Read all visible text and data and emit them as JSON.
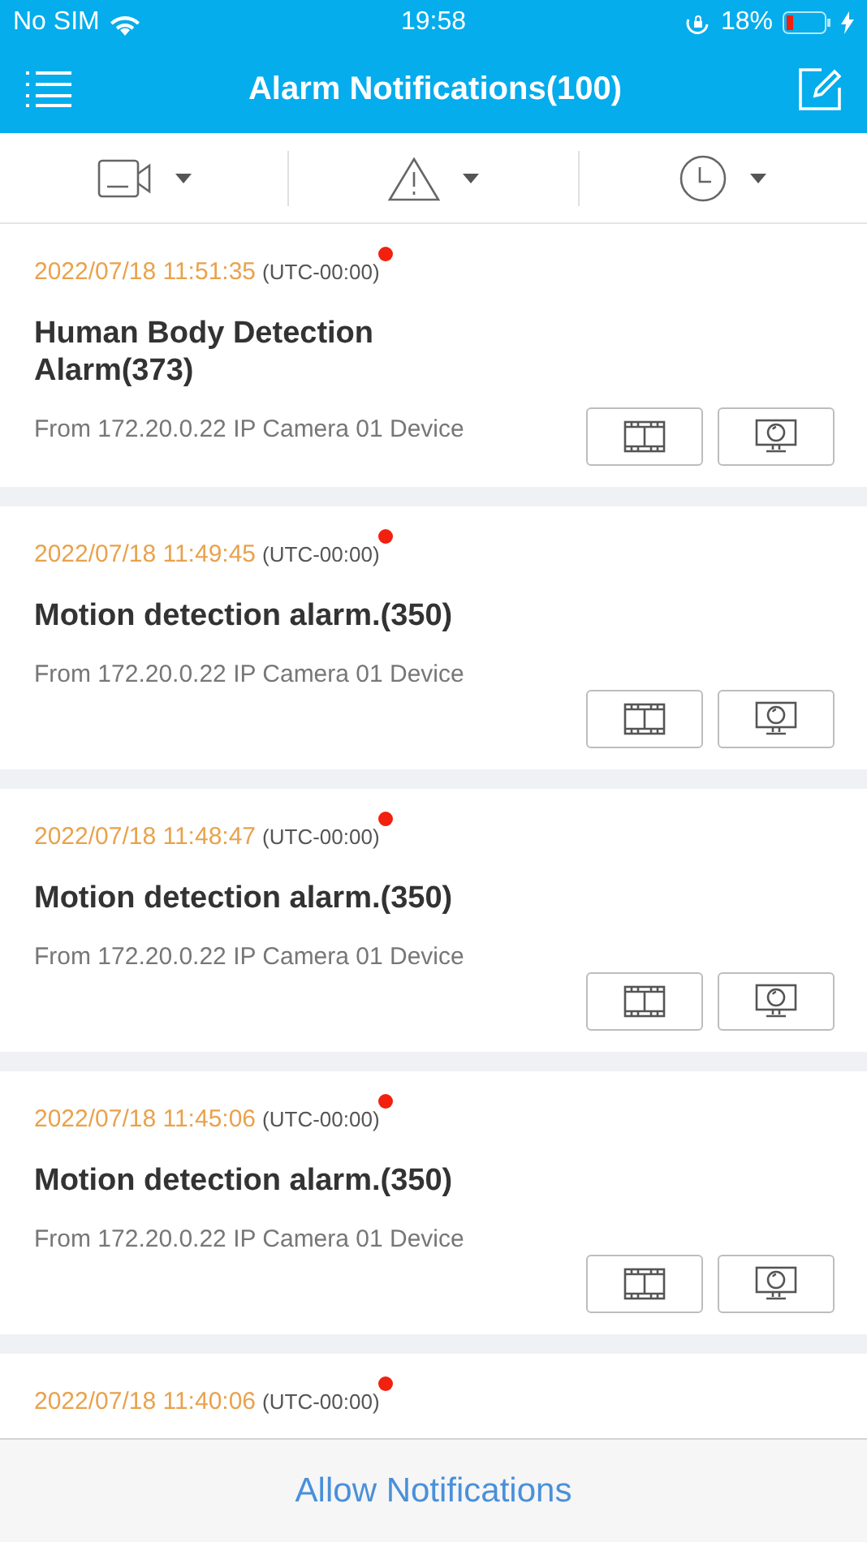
{
  "status_bar": {
    "carrier": "No SIM",
    "time": "19:58",
    "battery": "18%"
  },
  "nav_bar": {
    "title": "Alarm Notifications(100)"
  },
  "filters": [
    {
      "kind": "camera"
    },
    {
      "kind": "warning"
    },
    {
      "kind": "clock"
    }
  ],
  "alarms": [
    {
      "time": "2022/07/18 11:51:35",
      "zone": "(UTC-00:00)",
      "unread": true,
      "title": "Human Body Detection Alarm(373)",
      "source": "From 172.20.0.22 IP Camera 01 Device"
    },
    {
      "time": "2022/07/18 11:49:45",
      "zone": "(UTC-00:00)",
      "unread": true,
      "title": "Motion detection alarm.(350)",
      "source": "From 172.20.0.22 IP Camera 01 Device"
    },
    {
      "time": "2022/07/18 11:48:47",
      "zone": "(UTC-00:00)",
      "unread": true,
      "title": "Motion detection alarm.(350)",
      "source": "From 172.20.0.22 IP Camera 01 Device"
    },
    {
      "time": "2022/07/18 11:45:06",
      "zone": "(UTC-00:00)",
      "unread": true,
      "title": "Motion detection alarm.(350)",
      "source": "From 172.20.0.22 IP Camera 01 Device"
    },
    {
      "time": "2022/07/18 11:40:06",
      "zone": "(UTC-00:00)",
      "unread": true
    }
  ],
  "bottom_bar": {
    "link": "Allow Notifications"
  }
}
